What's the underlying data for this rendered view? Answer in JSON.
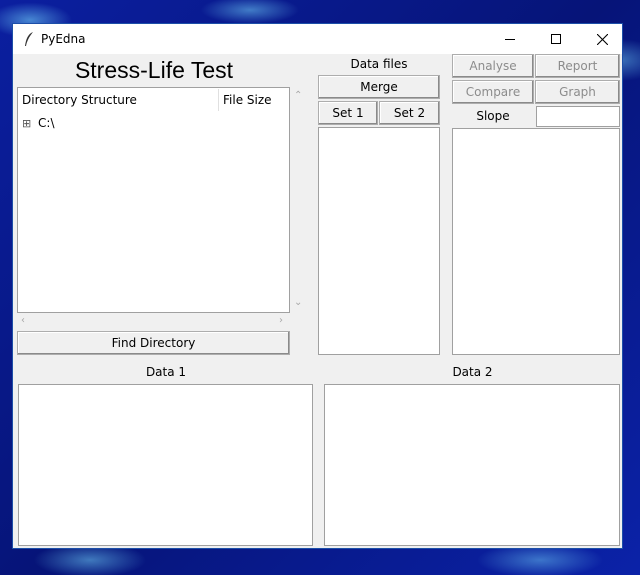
{
  "window": {
    "title": "PyEdna"
  },
  "heading": "Stress-Life Test",
  "tree": {
    "columns": [
      "Directory Structure",
      "File Size"
    ],
    "root": {
      "expander": "⊞",
      "label": "C:\\"
    }
  },
  "buttons": {
    "find_directory": "Find Directory",
    "merge": "Merge",
    "set1": "Set 1",
    "set2": "Set 2",
    "analyse": "Analyse",
    "report": "Report",
    "compare": "Compare",
    "graph": "Graph"
  },
  "labels": {
    "data_files": "Data files",
    "slope": "Slope",
    "data1": "Data 1",
    "data2": "Data 2"
  },
  "slope_value": ""
}
